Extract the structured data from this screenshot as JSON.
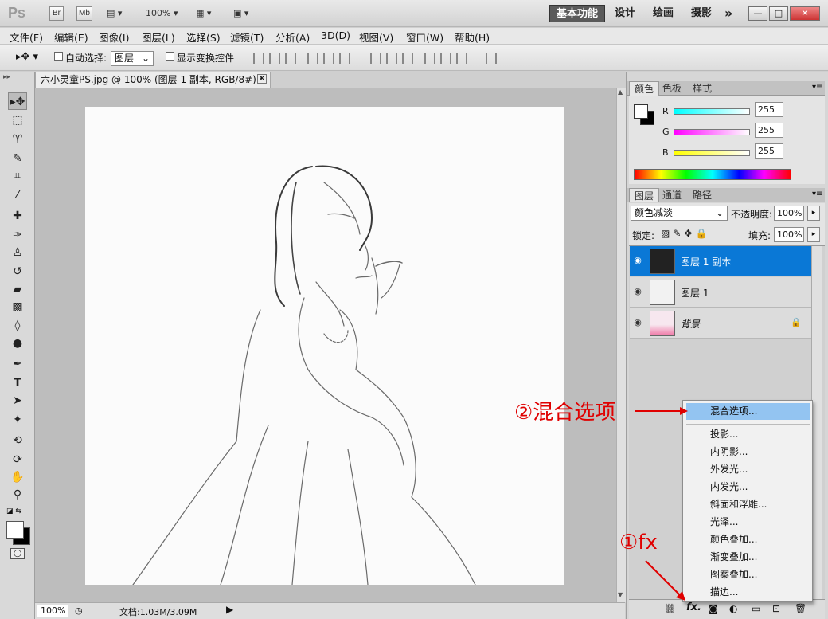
{
  "titlebar": {
    "logo": "Ps",
    "bridge_btn": "Br",
    "minibridge_btn": "Mb",
    "zoom_label": "100%",
    "workspaces": [
      "基本功能",
      "设计",
      "绘画",
      "摄影"
    ],
    "more": "»"
  },
  "menubar": {
    "items": [
      "文件(F)",
      "编辑(E)",
      "图像(I)",
      "图层(L)",
      "选择(S)",
      "滤镜(T)",
      "分析(A)",
      "3D(D)",
      "视图(V)",
      "窗口(W)",
      "帮助(H)"
    ]
  },
  "options": {
    "auto_select_label": "自动选择:",
    "auto_select_value": "图层",
    "show_transform_label": "显示变换控件"
  },
  "document": {
    "tab_title": "六小灵童PS.jpg @ 100% (图层 1 副本, RGB/8#) *",
    "close": "×"
  },
  "status": {
    "zoom": "100%",
    "doc_info": "文档:1.03M/3.09M"
  },
  "color_panel": {
    "tabs": [
      "颜色",
      "色板",
      "样式"
    ],
    "channels": [
      {
        "label": "R",
        "value": "255",
        "color": "#00d8d8"
      },
      {
        "label": "G",
        "value": "255",
        "color": "#e020e0"
      },
      {
        "label": "B",
        "value": "255",
        "color": "#e8e800"
      }
    ]
  },
  "layers_panel": {
    "tabs": [
      "图层",
      "通道",
      "路径"
    ],
    "blend_mode": "颜色减淡",
    "opacity_label": "不透明度:",
    "opacity_value": "100%",
    "lock_label": "锁定:",
    "fill_label": "填充:",
    "fill_value": "100%",
    "layers": [
      {
        "name": "图层 1 副本",
        "selected": true
      },
      {
        "name": "图层 1",
        "selected": false
      },
      {
        "name": "背景",
        "selected": false
      }
    ]
  },
  "context_menu": {
    "items": [
      "混合选项...",
      "投影...",
      "内阴影...",
      "外发光...",
      "内发光...",
      "斜面和浮雕...",
      "光泽...",
      "颜色叠加...",
      "渐变叠加...",
      "图案叠加...",
      "描边..."
    ]
  },
  "annotations": {
    "step1": "①fx",
    "step2": "②混合选项"
  },
  "colors": {
    "accent": "#0a78d6",
    "highlight": "#93c4f1",
    "annotation": "#e00000"
  }
}
